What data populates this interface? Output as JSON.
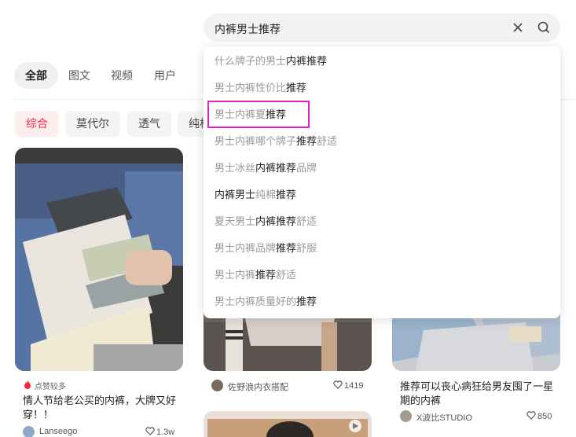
{
  "search": {
    "query": "内裤男士推荐"
  },
  "tabs": [
    "全部",
    "图文",
    "视频",
    "用户"
  ],
  "chips": [
    "综合",
    "莫代尔",
    "透气",
    "纯棉"
  ],
  "suggestions": [
    [
      [
        "什么牌子的",
        "n"
      ],
      [
        "男士",
        "n"
      ],
      [
        "内裤推荐",
        "h"
      ]
    ],
    [
      [
        "男士内裤",
        "n"
      ],
      [
        "性价比",
        "n"
      ],
      [
        "推荐",
        "h"
      ]
    ],
    [
      [
        "男士内裤",
        "n"
      ],
      [
        "夏",
        "n"
      ],
      [
        "推荐",
        "h"
      ]
    ],
    [
      [
        "男士内裤",
        "n"
      ],
      [
        "哪个牌子",
        "n"
      ],
      [
        "推荐",
        "h"
      ],
      [
        "舒适",
        "n"
      ]
    ],
    [
      [
        "男士冰丝",
        "n"
      ],
      [
        "内裤推荐",
        "h"
      ],
      [
        "品牌",
        "n"
      ]
    ],
    [
      [
        "内裤男士",
        "h"
      ],
      [
        "纯棉",
        "n"
      ],
      [
        "推荐",
        "h"
      ]
    ],
    [
      [
        "夏天男士",
        "n"
      ],
      [
        "内裤推荐",
        "h"
      ],
      [
        "舒适",
        "n"
      ]
    ],
    [
      [
        "男士内裤",
        "n"
      ],
      [
        "品牌",
        "n"
      ],
      [
        "推荐",
        "h"
      ],
      [
        "舒服",
        "n"
      ]
    ],
    [
      [
        "男士内裤",
        "n"
      ],
      [
        "推荐",
        "h"
      ],
      [
        "舒适",
        "n"
      ]
    ],
    [
      [
        "男士内裤",
        "n"
      ],
      [
        "质量好的",
        "n"
      ],
      [
        "推荐",
        "h"
      ]
    ]
  ],
  "cards": {
    "card1": {
      "tag": "点赞较多",
      "title": "情人节给老公买的内裤，大牌又好穿！！",
      "author": "Lanseego",
      "likes": "1.3w"
    },
    "card2": {
      "author": "佐野浪内衣搭配",
      "likes": "1419"
    },
    "card3": {
      "title": "推荐可以丧心病狂给男友囤了一星期的内裤",
      "author": "X波比STUDIO",
      "likes": "850"
    }
  },
  "colors": {
    "accent": "#ff2442",
    "highlight_box": "#e020c8"
  }
}
